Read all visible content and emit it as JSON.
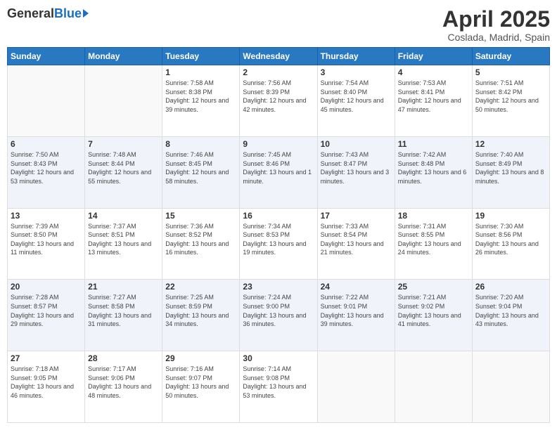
{
  "header": {
    "logo_general": "General",
    "logo_blue": "Blue",
    "month_year": "April 2025",
    "location": "Coslada, Madrid, Spain"
  },
  "days_of_week": [
    "Sunday",
    "Monday",
    "Tuesday",
    "Wednesday",
    "Thursday",
    "Friday",
    "Saturday"
  ],
  "weeks": [
    [
      {
        "day": "",
        "sunrise": "",
        "sunset": "",
        "daylight": ""
      },
      {
        "day": "",
        "sunrise": "",
        "sunset": "",
        "daylight": ""
      },
      {
        "day": "1",
        "sunrise": "Sunrise: 7:58 AM",
        "sunset": "Sunset: 8:38 PM",
        "daylight": "Daylight: 12 hours and 39 minutes."
      },
      {
        "day": "2",
        "sunrise": "Sunrise: 7:56 AM",
        "sunset": "Sunset: 8:39 PM",
        "daylight": "Daylight: 12 hours and 42 minutes."
      },
      {
        "day": "3",
        "sunrise": "Sunrise: 7:54 AM",
        "sunset": "Sunset: 8:40 PM",
        "daylight": "Daylight: 12 hours and 45 minutes."
      },
      {
        "day": "4",
        "sunrise": "Sunrise: 7:53 AM",
        "sunset": "Sunset: 8:41 PM",
        "daylight": "Daylight: 12 hours and 47 minutes."
      },
      {
        "day": "5",
        "sunrise": "Sunrise: 7:51 AM",
        "sunset": "Sunset: 8:42 PM",
        "daylight": "Daylight: 12 hours and 50 minutes."
      }
    ],
    [
      {
        "day": "6",
        "sunrise": "Sunrise: 7:50 AM",
        "sunset": "Sunset: 8:43 PM",
        "daylight": "Daylight: 12 hours and 53 minutes."
      },
      {
        "day": "7",
        "sunrise": "Sunrise: 7:48 AM",
        "sunset": "Sunset: 8:44 PM",
        "daylight": "Daylight: 12 hours and 55 minutes."
      },
      {
        "day": "8",
        "sunrise": "Sunrise: 7:46 AM",
        "sunset": "Sunset: 8:45 PM",
        "daylight": "Daylight: 12 hours and 58 minutes."
      },
      {
        "day": "9",
        "sunrise": "Sunrise: 7:45 AM",
        "sunset": "Sunset: 8:46 PM",
        "daylight": "Daylight: 13 hours and 1 minute."
      },
      {
        "day": "10",
        "sunrise": "Sunrise: 7:43 AM",
        "sunset": "Sunset: 8:47 PM",
        "daylight": "Daylight: 13 hours and 3 minutes."
      },
      {
        "day": "11",
        "sunrise": "Sunrise: 7:42 AM",
        "sunset": "Sunset: 8:48 PM",
        "daylight": "Daylight: 13 hours and 6 minutes."
      },
      {
        "day": "12",
        "sunrise": "Sunrise: 7:40 AM",
        "sunset": "Sunset: 8:49 PM",
        "daylight": "Daylight: 13 hours and 8 minutes."
      }
    ],
    [
      {
        "day": "13",
        "sunrise": "Sunrise: 7:39 AM",
        "sunset": "Sunset: 8:50 PM",
        "daylight": "Daylight: 13 hours and 11 minutes."
      },
      {
        "day": "14",
        "sunrise": "Sunrise: 7:37 AM",
        "sunset": "Sunset: 8:51 PM",
        "daylight": "Daylight: 13 hours and 13 minutes."
      },
      {
        "day": "15",
        "sunrise": "Sunrise: 7:36 AM",
        "sunset": "Sunset: 8:52 PM",
        "daylight": "Daylight: 13 hours and 16 minutes."
      },
      {
        "day": "16",
        "sunrise": "Sunrise: 7:34 AM",
        "sunset": "Sunset: 8:53 PM",
        "daylight": "Daylight: 13 hours and 19 minutes."
      },
      {
        "day": "17",
        "sunrise": "Sunrise: 7:33 AM",
        "sunset": "Sunset: 8:54 PM",
        "daylight": "Daylight: 13 hours and 21 minutes."
      },
      {
        "day": "18",
        "sunrise": "Sunrise: 7:31 AM",
        "sunset": "Sunset: 8:55 PM",
        "daylight": "Daylight: 13 hours and 24 minutes."
      },
      {
        "day": "19",
        "sunrise": "Sunrise: 7:30 AM",
        "sunset": "Sunset: 8:56 PM",
        "daylight": "Daylight: 13 hours and 26 minutes."
      }
    ],
    [
      {
        "day": "20",
        "sunrise": "Sunrise: 7:28 AM",
        "sunset": "Sunset: 8:57 PM",
        "daylight": "Daylight: 13 hours and 29 minutes."
      },
      {
        "day": "21",
        "sunrise": "Sunrise: 7:27 AM",
        "sunset": "Sunset: 8:58 PM",
        "daylight": "Daylight: 13 hours and 31 minutes."
      },
      {
        "day": "22",
        "sunrise": "Sunrise: 7:25 AM",
        "sunset": "Sunset: 8:59 PM",
        "daylight": "Daylight: 13 hours and 34 minutes."
      },
      {
        "day": "23",
        "sunrise": "Sunrise: 7:24 AM",
        "sunset": "Sunset: 9:00 PM",
        "daylight": "Daylight: 13 hours and 36 minutes."
      },
      {
        "day": "24",
        "sunrise": "Sunrise: 7:22 AM",
        "sunset": "Sunset: 9:01 PM",
        "daylight": "Daylight: 13 hours and 39 minutes."
      },
      {
        "day": "25",
        "sunrise": "Sunrise: 7:21 AM",
        "sunset": "Sunset: 9:02 PM",
        "daylight": "Daylight: 13 hours and 41 minutes."
      },
      {
        "day": "26",
        "sunrise": "Sunrise: 7:20 AM",
        "sunset": "Sunset: 9:04 PM",
        "daylight": "Daylight: 13 hours and 43 minutes."
      }
    ],
    [
      {
        "day": "27",
        "sunrise": "Sunrise: 7:18 AM",
        "sunset": "Sunset: 9:05 PM",
        "daylight": "Daylight: 13 hours and 46 minutes."
      },
      {
        "day": "28",
        "sunrise": "Sunrise: 7:17 AM",
        "sunset": "Sunset: 9:06 PM",
        "daylight": "Daylight: 13 hours and 48 minutes."
      },
      {
        "day": "29",
        "sunrise": "Sunrise: 7:16 AM",
        "sunset": "Sunset: 9:07 PM",
        "daylight": "Daylight: 13 hours and 50 minutes."
      },
      {
        "day": "30",
        "sunrise": "Sunrise: 7:14 AM",
        "sunset": "Sunset: 9:08 PM",
        "daylight": "Daylight: 13 hours and 53 minutes."
      },
      {
        "day": "",
        "sunrise": "",
        "sunset": "",
        "daylight": ""
      },
      {
        "day": "",
        "sunrise": "",
        "sunset": "",
        "daylight": ""
      },
      {
        "day": "",
        "sunrise": "",
        "sunset": "",
        "daylight": ""
      }
    ]
  ]
}
